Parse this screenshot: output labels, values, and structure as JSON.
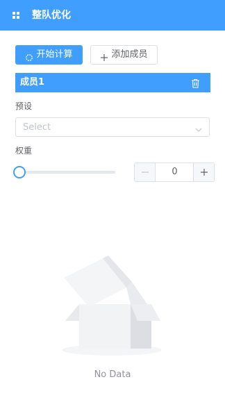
{
  "header": {
    "title": "整队优化",
    "menu_icon": "grid-icon"
  },
  "actions": {
    "calculate_label": "开始计算",
    "add_member_label": "添加成员"
  },
  "member": {
    "name": "成员1",
    "delete_icon": "trash-icon"
  },
  "preset": {
    "label": "预设",
    "placeholder": "Select"
  },
  "weight": {
    "label": "权重",
    "value": "0",
    "slider_value": 0
  },
  "empty": {
    "text": "No Data"
  },
  "colors": {
    "primary": "#409eff",
    "border": "#dcdfe6",
    "placeholder": "#c0c4cc"
  }
}
